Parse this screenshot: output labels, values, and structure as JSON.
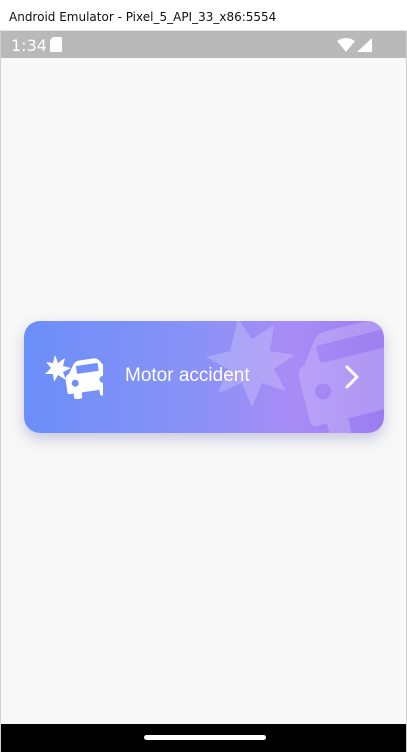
{
  "window": {
    "title": "Android Emulator - Pixel_5_API_33_x86:5554"
  },
  "status_bar": {
    "time": "1:34",
    "icons": [
      "sd-card-icon",
      "wifi-icon",
      "signal-icon"
    ]
  },
  "card": {
    "label": "Motor accident",
    "icon": "car-crash-icon",
    "chevron": "chevron-right-icon",
    "gradient_start": "#6b8ef8",
    "gradient_end": "#9a7cf0"
  },
  "colors": {
    "status_bar_bg": "#b9b9b9",
    "screen_bg": "#f8f8f8",
    "nav_bar_bg": "#000000"
  }
}
